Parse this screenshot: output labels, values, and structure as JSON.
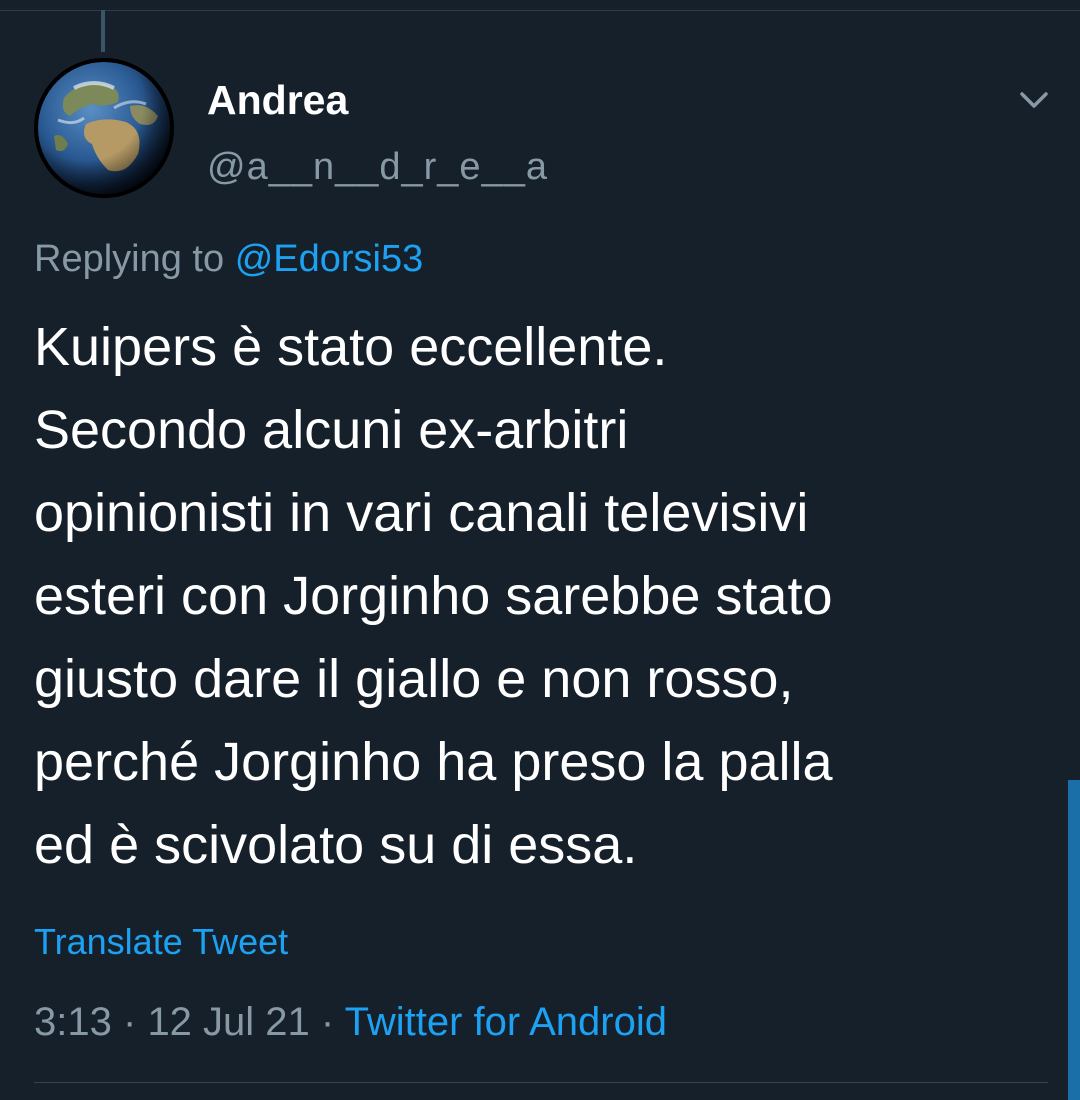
{
  "tweet": {
    "author_name": "Andrea",
    "author_handle": "@a__n__d_r_e__a",
    "replying_prefix": "Replying to",
    "replying_to": "@Edorsi53",
    "text_lines": [
      "Kuipers è stato eccellente.",
      "Secondo alcuni ex-arbitri",
      "opinionisti in vari canali televisivi",
      "esteri con Jorginho sarebbe stato",
      "giusto dare il giallo e non rosso,",
      "perché Jorginho ha preso la palla",
      "ed è scivolato su di essa."
    ],
    "translate_label": "Translate Tweet",
    "time": "3:13",
    "date": "12 Jul 21",
    "separator": "·",
    "source": "Twitter for Android"
  },
  "icons": {
    "avatar": "earth-globe-avatar",
    "menu": "chevron-down-icon"
  },
  "colors": {
    "background": "#15202b",
    "primary_text": "#ffffff",
    "secondary_text": "#8899a6",
    "accent": "#1da1f2"
  }
}
